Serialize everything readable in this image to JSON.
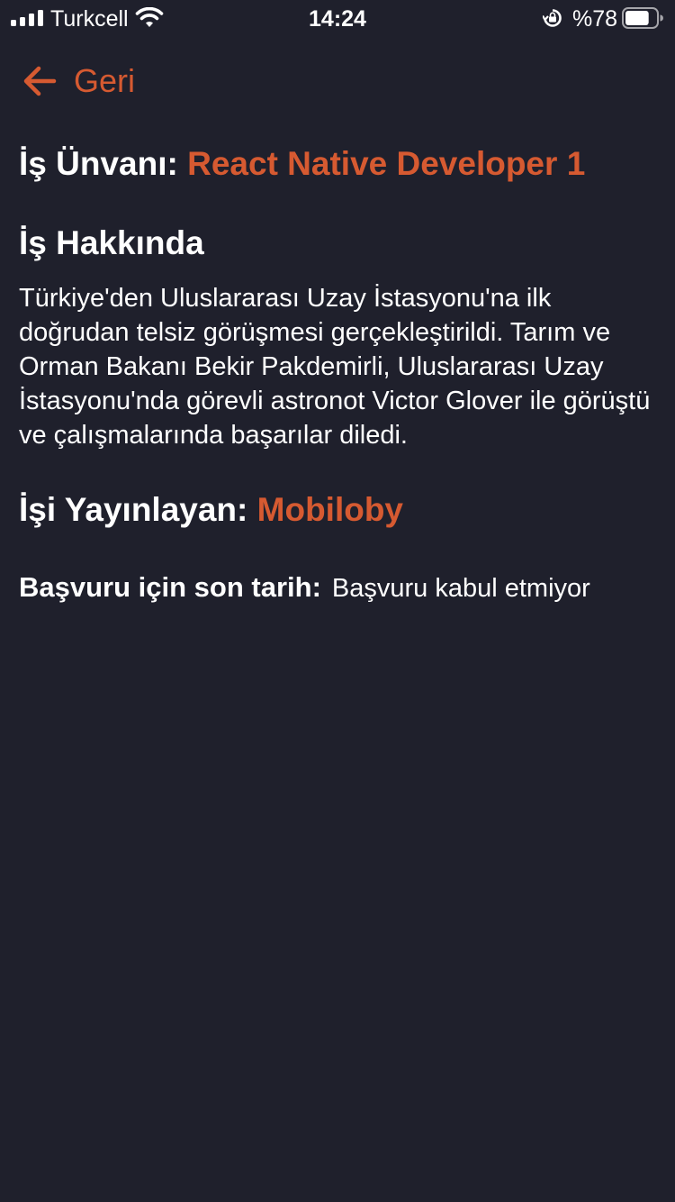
{
  "status_bar": {
    "carrier": "Turkcell",
    "time": "14:24",
    "battery_percent": "%78",
    "battery_level": 0.78,
    "signal_bars": 4,
    "icons": [
      "signal-bars-icon",
      "wifi-icon",
      "rotation-lock-icon",
      "battery-icon"
    ]
  },
  "nav": {
    "back_label": "Geri",
    "back_icon": "arrow-left-icon"
  },
  "job": {
    "title_label": "İş Ünvanı:",
    "title_value": "React Native Developer 1",
    "about_heading": "İş Hakkında",
    "about_text": "Türkiye'den Uluslararası Uzay İstasyonu'na ilk doğrudan telsiz görüşmesi gerçekleştirildi. Tarım ve Orman Bakanı Bekir Pakdemirli, Uluslararası Uzay İstasyonu'nda görevli astronot Victor Glover ile görüştü ve çalışmalarında başarılar diledi.",
    "publisher_label": "İşi Yayınlayan:",
    "publisher_value": "Mobiloby",
    "deadline_label": "Başvuru için son tarih:",
    "deadline_value": "Başvuru kabul etmiyor"
  },
  "colors": {
    "background": "#1f202c",
    "accent": "#d65a31",
    "text": "#ffffff"
  }
}
